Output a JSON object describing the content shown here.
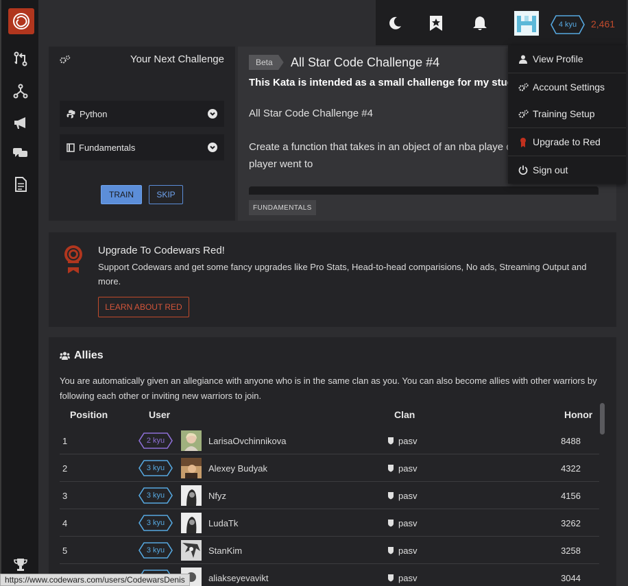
{
  "topbar": {
    "rank": "4 kyu",
    "honor": "2,461"
  },
  "next_challenge": {
    "title": "Your Next Challenge",
    "language": "Python",
    "category": "Fundamentals",
    "train_label": "TRAIN",
    "skip_label": "SKIP"
  },
  "kata": {
    "beta_label": "Beta",
    "title": "All Star Code Challenge #4",
    "intro": "This Kata is intended as a small challenge for my studen",
    "subtitle": "All Star Code Challenge #4",
    "description": "Create a function that takes in an object of an nba playe college that the player went to",
    "tag": "FUNDAMENTALS"
  },
  "user_menu": {
    "items": [
      {
        "label": "View Profile",
        "icon": "user-icon"
      },
      {
        "label": "Account Settings",
        "icon": "gears-icon"
      },
      {
        "label": "Training Setup",
        "icon": "gears-icon"
      },
      {
        "label": "Upgrade to Red",
        "icon": "ribbon-icon"
      },
      {
        "label": "Sign out",
        "icon": "power-icon"
      }
    ]
  },
  "upgrade": {
    "title": "Upgrade To Codewars Red!",
    "text": "Support Codewars and get some fancy upgrades like Pro Stats, Head-to-head comparisions, No ads, Streaming Output and more.",
    "button_label": "LEARN ABOUT RED"
  },
  "allies": {
    "title": "Allies",
    "description": "You are automatically given an allegiance with anyone who is in the same clan as you. You can also become allies with other warriors by following each other or inviting new warriors to join.",
    "columns": [
      "Position",
      "User",
      "Clan",
      "Honor"
    ],
    "rows": [
      {
        "position": "1",
        "rank": "2 kyu",
        "user": "LarisaOvchinnikova",
        "clan": "pasv",
        "honor": "8488"
      },
      {
        "position": "2",
        "rank": "3 kyu",
        "user": "Alexey Budyak",
        "clan": "pasv",
        "honor": "4322"
      },
      {
        "position": "3",
        "rank": "3 kyu",
        "user": "Nfyz",
        "clan": "pasv",
        "honor": "4156"
      },
      {
        "position": "4",
        "rank": "3 kyu",
        "user": "LudaTk",
        "clan": "pasv",
        "honor": "3262"
      },
      {
        "position": "5",
        "rank": "3 kyu",
        "user": "StanKim",
        "clan": "pasv",
        "honor": "3258"
      },
      {
        "position": "",
        "rank": "",
        "user": "aliakseyevavikt",
        "clan": "pasv",
        "honor": "3044"
      }
    ]
  },
  "colors": {
    "accent_red": "#b1361e",
    "rank_blue": "#56a8e0",
    "rank_purple": "#8d6fd6",
    "button_blue": "#5c8ed9"
  },
  "status_url": "https://www.codewars.com/users/CodewarsDenis"
}
